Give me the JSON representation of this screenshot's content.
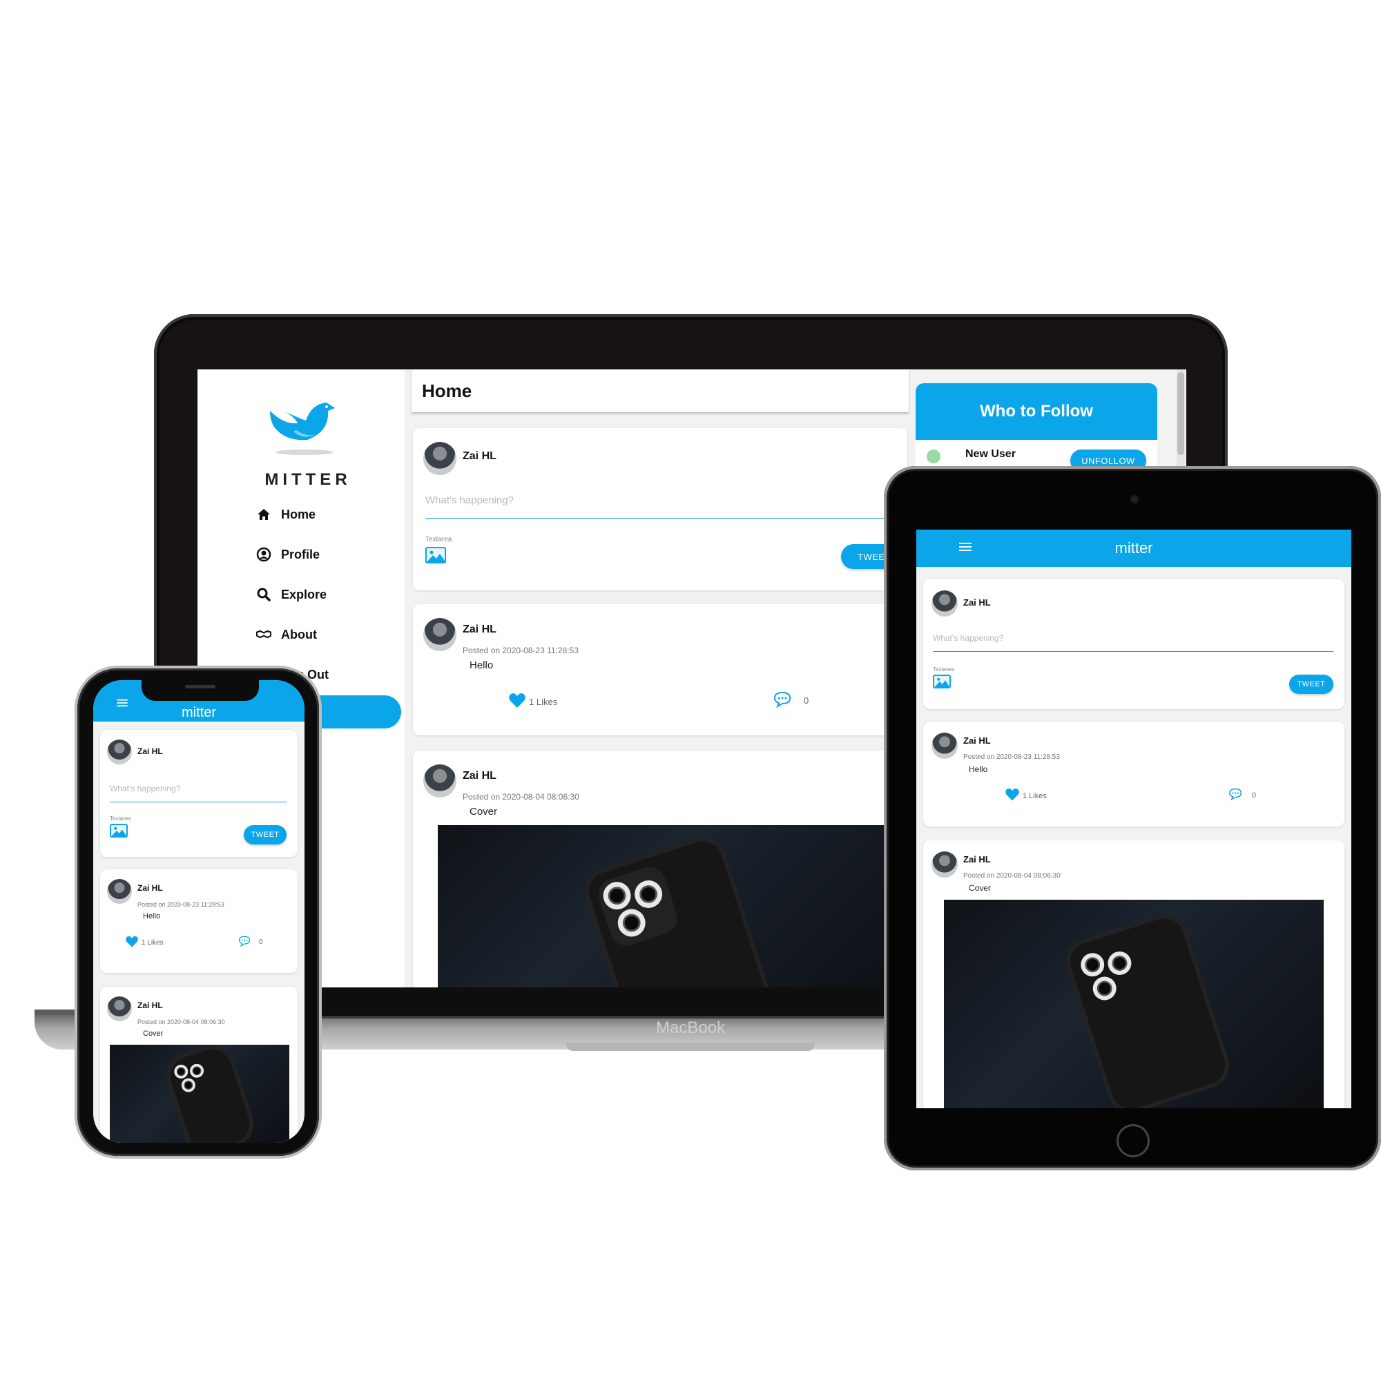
{
  "app": {
    "brand": "MITTER",
    "brand_mobile": "mitter",
    "accent_color": "#0ba5e9",
    "device_label": "MacBook"
  },
  "nav": {
    "items": [
      {
        "label": "Home",
        "icon": "home-icon"
      },
      {
        "label": "Profile",
        "icon": "user-circle-icon"
      },
      {
        "label": "Explore",
        "icon": "search-icon"
      },
      {
        "label": "About",
        "icon": "handshake-icon"
      },
      {
        "label": "Log Out",
        "icon": "logout-icon"
      }
    ]
  },
  "header": {
    "title": "Home"
  },
  "composer": {
    "user": "Zai HL",
    "placeholder": "What's happening?",
    "field_label": "Textarea",
    "submit_label": "TWEET"
  },
  "posts": [
    {
      "user": "Zai HL",
      "posted": "Posted on 2020-08-23 11:28:53",
      "text": "Hello",
      "likes": "1 Likes",
      "comments": "0"
    },
    {
      "user": "Zai HL",
      "posted": "Posted on 2020-08-04 08:06:30",
      "text": "Cover",
      "has_image": true
    }
  ],
  "who_to_follow": {
    "title": "Who to Follow",
    "users": [
      {
        "name": "New User",
        "action": "UNFOLLOW"
      }
    ]
  }
}
